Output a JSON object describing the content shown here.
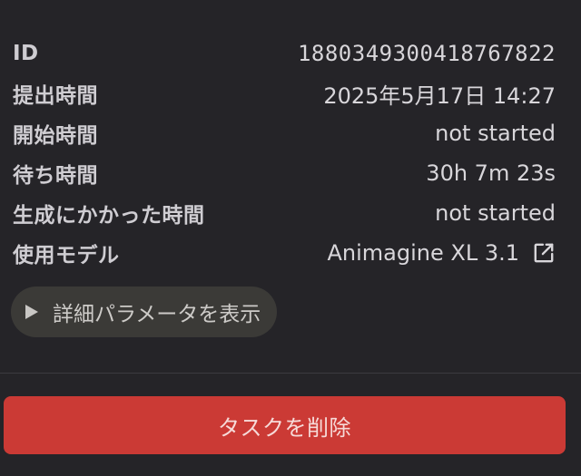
{
  "task_info": {
    "rows": [
      {
        "label": "ID",
        "value": "1880349300418767822"
      },
      {
        "label": "提出時間",
        "value": "2025年5月17日 14:27"
      },
      {
        "label": "開始時間",
        "value": "not started"
      },
      {
        "label": "待ち時間",
        "value": "30h 7m 23s"
      },
      {
        "label": "生成にかかった時間",
        "value": "not started"
      },
      {
        "label": "使用モデル",
        "value": "Animagine XL 3.1",
        "icon": "external-link-icon"
      }
    ]
  },
  "details_toggle": {
    "label": "詳細パラメータを表示",
    "icon": "play-triangle-icon",
    "expanded": false
  },
  "delete_button": {
    "label": "タスクを削除",
    "color": "#cb3a35"
  },
  "colors": {
    "background": "#252428",
    "text": "#d6d4d9",
    "toggle_background": "#3b3a37",
    "danger": "#cb3a35"
  }
}
